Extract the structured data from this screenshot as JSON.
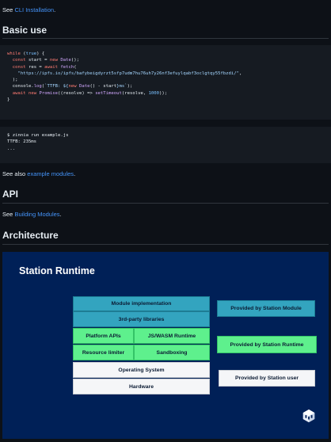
{
  "intro": {
    "prefix": "See ",
    "link": "CLI Installation",
    "suffix": "."
  },
  "basic_use": {
    "heading": "Basic use",
    "code_lines": [
      [
        {
          "t": "while",
          "c": "kw"
        },
        {
          "t": " ("
        },
        {
          "t": "true",
          "c": "nm"
        },
        {
          "t": ") {"
        }
      ],
      [
        {
          "t": "  "
        },
        {
          "t": "const",
          "c": "kw"
        },
        {
          "t": " start = "
        },
        {
          "t": "new",
          "c": "kw"
        },
        {
          "t": " "
        },
        {
          "t": "Date",
          "c": "fn"
        },
        {
          "t": "();"
        }
      ],
      [
        {
          "t": "  "
        },
        {
          "t": "const",
          "c": "kw"
        },
        {
          "t": " res = "
        },
        {
          "t": "await",
          "c": "kw"
        },
        {
          "t": " "
        },
        {
          "t": "fetch",
          "c": "fn"
        },
        {
          "t": "("
        }
      ],
      [
        {
          "t": "    "
        },
        {
          "t": "\"https://ipfs.io/ipfs/bafybeigdyrzt5sfp7udm7hu76uh7y26nf3efuylqabf3oclgtqy55fbzdi/\"",
          "c": "st"
        },
        {
          "t": ","
        }
      ],
      [
        {
          "t": "  );"
        }
      ],
      [
        {
          "t": "  console."
        },
        {
          "t": "log",
          "c": "fn"
        },
        {
          "t": "("
        },
        {
          "t": "`TTFB: ${",
          "c": "st"
        },
        {
          "t": "new",
          "c": "kw"
        },
        {
          "t": " "
        },
        {
          "t": "Date",
          "c": "fn"
        },
        {
          "t": "() - start"
        },
        {
          "t": "}ms`",
          "c": "st"
        },
        {
          "t": ");"
        }
      ],
      [
        {
          "t": "  "
        },
        {
          "t": "await",
          "c": "kw"
        },
        {
          "t": " "
        },
        {
          "t": "new",
          "c": "kw"
        },
        {
          "t": " "
        },
        {
          "t": "Promise",
          "c": "fn"
        },
        {
          "t": "((resolve) => "
        },
        {
          "t": "setTimeout",
          "c": "fn"
        },
        {
          "t": "(resolve, "
        },
        {
          "t": "1000",
          "c": "nm"
        },
        {
          "t": "));"
        }
      ],
      [
        {
          "t": "}"
        }
      ]
    ],
    "terminal_lines": [
      "$ zinnia run example.js",
      "TTFB: 235ms",
      "..."
    ],
    "see_also": {
      "prefix": "See also ",
      "link": "example modules",
      "suffix": "."
    }
  },
  "api": {
    "heading": "API",
    "text": {
      "prefix": "See ",
      "link": "Building Modules",
      "suffix": "."
    }
  },
  "architecture": {
    "heading": "Architecture",
    "diagram": {
      "title": "Station Runtime",
      "layers": {
        "module_implementation": "Module implementation",
        "third_party": "3rd-party libraries",
        "platform_apis": "Platform APIs",
        "js_wasm_runtime": "JS/WASM Runtime",
        "resource_limiter": "Resource limiter",
        "sandboxing": "Sandboxing",
        "operating_system": "Operating System",
        "hardware": "Hardware"
      },
      "legend": {
        "module": "Provided by Station Module",
        "runtime": "Provided by Station Runtime",
        "user": "Provided by Station user"
      },
      "colors": {
        "module": "#33a4bf",
        "runtime": "#5ef08d",
        "user": "#f5f6f8",
        "background": "#002057"
      }
    }
  }
}
